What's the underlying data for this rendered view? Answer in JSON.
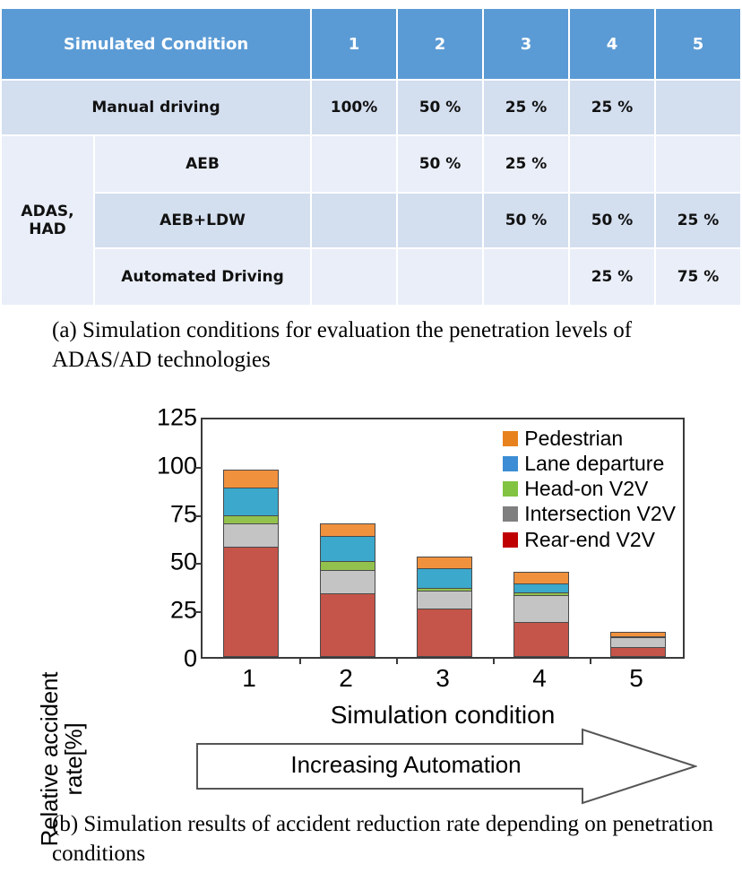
{
  "table": {
    "header": {
      "title": "Simulated Condition",
      "columns": [
        "1",
        "2",
        "3",
        "4",
        "5"
      ]
    },
    "group_label": "ADAS,\nHAD",
    "rows": [
      {
        "label": "Manual driving",
        "values": [
          "100%",
          "50 %",
          "25 %",
          "25 %",
          ""
        ]
      },
      {
        "label": "AEB",
        "values": [
          "",
          "50 %",
          "25 %",
          "",
          ""
        ]
      },
      {
        "label": "AEB+LDW",
        "values": [
          "",
          "",
          "50 %",
          "50 %",
          "25 %"
        ]
      },
      {
        "label": "Automated Driving",
        "values": [
          "",
          "",
          "",
          "25 %",
          "75 %"
        ]
      }
    ],
    "colors": {
      "header_bg": "#5B9BD5",
      "header_text": "#FFFFFF",
      "row_dark": "#D3DEEF",
      "row_light": "#E9EEF8"
    }
  },
  "caption_a": "(a) Simulation conditions for evaluation the penetration levels of ADAS/AD technologies",
  "caption_b": "(b) Simulation results of accident reduction rate depending on penetration conditions",
  "arrow": {
    "label": "Increasing Automation"
  },
  "chart_data": {
    "type": "bar",
    "stacked": true,
    "title": "",
    "xlabel": "Simulation condition",
    "ylabel": "Relative accident\nrate[%]",
    "categories": [
      "1",
      "2",
      "3",
      "4",
      "5"
    ],
    "yticks": [
      0,
      25,
      50,
      75,
      100,
      125
    ],
    "ylim": [
      0,
      125
    ],
    "grid": false,
    "legend_position": "top-right",
    "series": [
      {
        "name": "Rear-end V2V",
        "color": "#C5544A",
        "legend_color": "#C00000",
        "values": [
          57,
          33,
          25,
          18,
          5
        ]
      },
      {
        "name": "Intersection V2V",
        "color": "#C4C4C4",
        "legend_color": "#7F7F7F",
        "values": [
          13,
          13,
          10,
          15,
          6
        ]
      },
      {
        "name": "Head-on V2V",
        "color": "#92C24D",
        "legend_color": "#82C341",
        "values": [
          5,
          5,
          2,
          2,
          1
        ]
      },
      {
        "name": "Lane departure",
        "color": "#3BA8CC",
        "legend_color": "#3C8DD5",
        "values": [
          15,
          14,
          11,
          5,
          1
        ]
      },
      {
        "name": "Pedestrian",
        "color": "#F0913E",
        "legend_color": "#E8821E",
        "values": [
          10,
          7,
          7,
          7,
          3
        ]
      }
    ],
    "legend_order": [
      "Pedestrian",
      "Lane departure",
      "Head-on V2V",
      "Intersection V2V",
      "Rear-end V2V"
    ],
    "totals": [
      100,
      72,
      55,
      47,
      16
    ]
  }
}
